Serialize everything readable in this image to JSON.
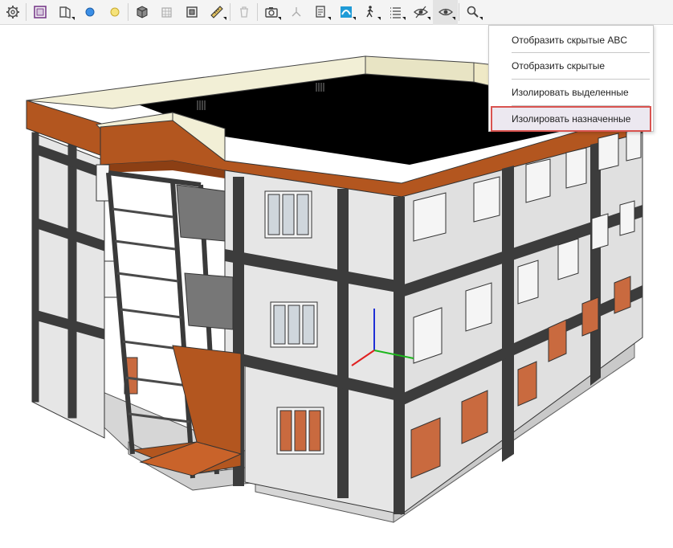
{
  "toolbar": {
    "tools": [
      "settings-icon",
      "frame-select-icon",
      "section-box-icon",
      "sphere-blue-icon",
      "sphere-yellow-icon",
      "cube-add-icon",
      "cube-grid-icon",
      "box-section-icon",
      "measure-icon",
      "delete-icon",
      "camera-icon",
      "axes-icon",
      "document-icon",
      "color-map-icon",
      "walk-icon",
      "list-icon",
      "hide-icon",
      "eye-icon",
      "search-icon"
    ]
  },
  "visibility_menu": {
    "items": [
      {
        "label": "Отобразить скрытые ABC"
      },
      {
        "label": "Отобразить скрытые"
      },
      {
        "label": "Изолировать выделенные"
      },
      {
        "label": "Изолировать назначенные",
        "highlighted": true
      }
    ]
  },
  "colors": {
    "accent_red": "#d9534f",
    "roof_orange": "#b3561f",
    "wall_light": "#e4e4e4",
    "frame_dark": "#3c3c3c"
  }
}
